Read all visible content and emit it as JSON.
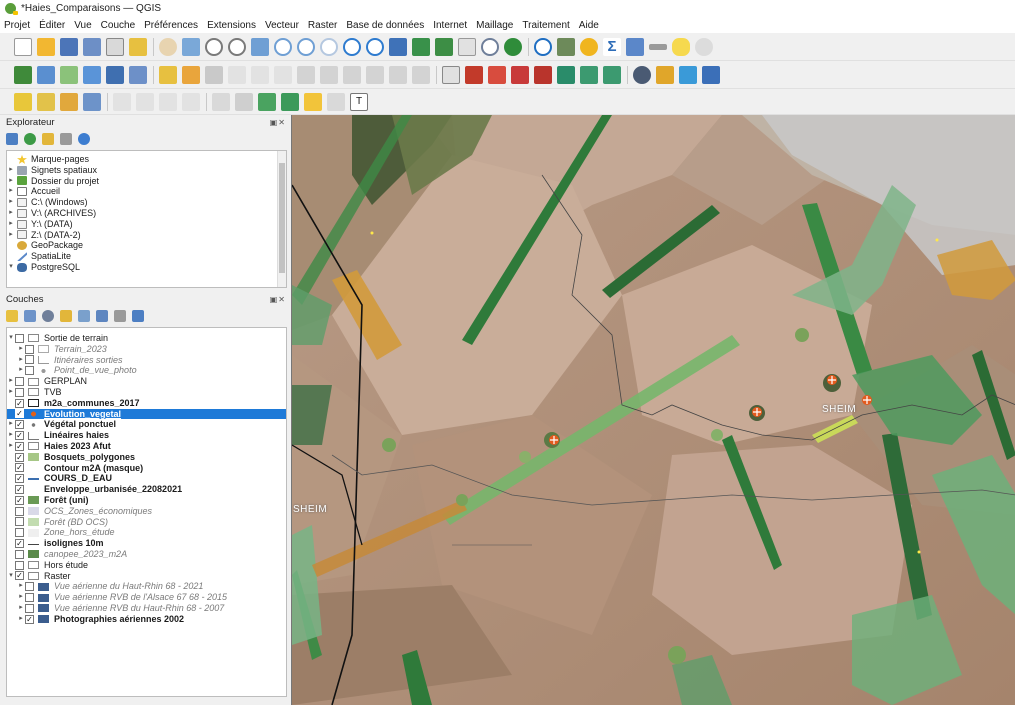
{
  "window": {
    "title": "*Haies_Comparaisons — QGIS"
  },
  "menu": [
    "Projet",
    "Éditer",
    "Vue",
    "Couche",
    "Préférences",
    "Extensions",
    "Vecteur",
    "Raster",
    "Base de données",
    "Internet",
    "Maillage",
    "Traitement",
    "Aide"
  ],
  "explorer": {
    "title": "Explorateur",
    "items": [
      {
        "label": "Marque-pages",
        "icon": "star-icon"
      },
      {
        "label": "Signets spatiaux",
        "icon": "bookmark-icon"
      },
      {
        "label": "Dossier du projet",
        "icon": "project-folder-icon"
      },
      {
        "label": "Accueil",
        "icon": "home-icon"
      },
      {
        "label": "C:\\ (Windows)",
        "icon": "drive-icon"
      },
      {
        "label": "V:\\ (ARCHIVES)",
        "icon": "drive-icon"
      },
      {
        "label": "Y:\\ (DATA)",
        "icon": "drive-icon"
      },
      {
        "label": "Z:\\ (DATA-2)",
        "icon": "drive-icon"
      },
      {
        "label": "GeoPackage",
        "icon": "geopackage-icon"
      },
      {
        "label": "SpatiaLite",
        "icon": "spatialite-icon"
      },
      {
        "label": "PostgreSQL",
        "icon": "postgresql-icon"
      }
    ]
  },
  "layers": {
    "title": "Couches",
    "items": [
      {
        "label": "Sortie de terrain"
      },
      {
        "label": "Terrain_2023"
      },
      {
        "label": "Itinéraires sorties"
      },
      {
        "label": "Point_de_vue_photo"
      },
      {
        "label": "GERPLAN"
      },
      {
        "label": "TVB"
      },
      {
        "label": "m2a_communes_2017"
      },
      {
        "label": "Evolution_vegetal"
      },
      {
        "label": "Végétal ponctuel"
      },
      {
        "label": "Linéaires haies"
      },
      {
        "label": "Haies 2023 Afut"
      },
      {
        "label": "Bosquets_polygones"
      },
      {
        "label": "Contour m2A (masque)"
      },
      {
        "label": "COURS_D_EAU"
      },
      {
        "label": "Enveloppe_urbanisée_22082021"
      },
      {
        "label": "Forêt (uni)"
      },
      {
        "label": "OCS_Zones_économiques"
      },
      {
        "label": "Forêt (BD OCS)"
      },
      {
        "label": "Zone_hors_étude"
      },
      {
        "label": "isolignes 10m"
      },
      {
        "label": "canopee_2023_m2A"
      },
      {
        "label": "Hors étude"
      },
      {
        "label": "Raster"
      },
      {
        "label": "Vue aérienne du Haut-Rhin 68 - 2021"
      },
      {
        "label": "Vue aérienne RVB de l'Alsace 67 68 - 2015"
      },
      {
        "label": "Vue aérienne RVB du Haut-Rhin 68 - 2007"
      },
      {
        "label": "Photographies aériennes 2002"
      }
    ]
  },
  "map": {
    "labels": [
      "SHEIM",
      "SHEIM"
    ]
  }
}
